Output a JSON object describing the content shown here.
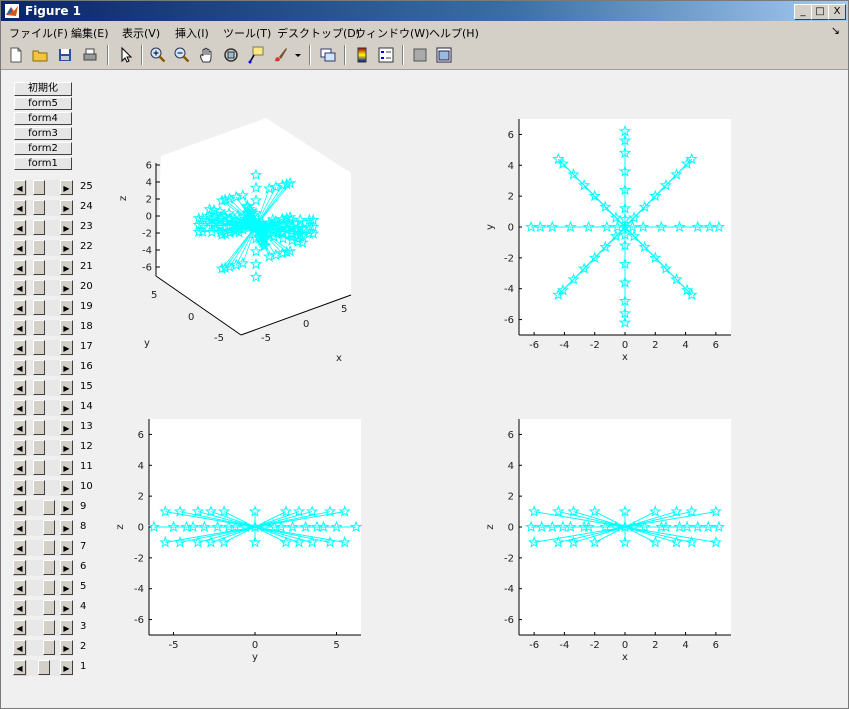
{
  "window": {
    "title": "Figure 1"
  },
  "titlebar_buttons": [
    "_",
    "□",
    "X"
  ],
  "menu": [
    "ファイル(F)",
    "編集(E)",
    "表示(V)",
    "挿入(I)",
    "ツール(T)",
    "デスクトップ(D)",
    "ウィンドウ(W)",
    "ヘルプ(H)"
  ],
  "toolbar_icons": [
    "new-file-icon",
    "open-folder-icon",
    "save-icon",
    "print-icon",
    "pointer-icon",
    "zoom-in-icon",
    "zoom-out-icon",
    "pan-hand-icon",
    "rotate-3d-icon",
    "data-cursor-icon",
    "brush-icon",
    "link-plot-icon",
    "colorbar-icon",
    "legend-icon",
    "hide-plot-tools-icon",
    "show-plot-tools-icon"
  ],
  "buttons": [
    "初期化",
    "form5",
    "form4",
    "form3",
    "form2",
    "form1"
  ],
  "sliders": [
    {
      "label": "25",
      "value": 0.32
    },
    {
      "label": "24",
      "value": 0.32
    },
    {
      "label": "23",
      "value": 0.32
    },
    {
      "label": "22",
      "value": 0.32
    },
    {
      "label": "21",
      "value": 0.32
    },
    {
      "label": "20",
      "value": 0.32
    },
    {
      "label": "19",
      "value": 0.32
    },
    {
      "label": "18",
      "value": 0.32
    },
    {
      "label": "17",
      "value": 0.32
    },
    {
      "label": "16",
      "value": 0.32
    },
    {
      "label": "15",
      "value": 0.32
    },
    {
      "label": "14",
      "value": 0.32
    },
    {
      "label": "13",
      "value": 0.32
    },
    {
      "label": "12",
      "value": 0.32
    },
    {
      "label": "11",
      "value": 0.32
    },
    {
      "label": "10",
      "value": 0.32
    },
    {
      "label": "9",
      "value": 0.78
    },
    {
      "label": "8",
      "value": 0.78
    },
    {
      "label": "7",
      "value": 0.78
    },
    {
      "label": "6",
      "value": 0.78
    },
    {
      "label": "5",
      "value": 0.78
    },
    {
      "label": "4",
      "value": 0.78
    },
    {
      "label": "3",
      "value": 0.78
    },
    {
      "label": "2",
      "value": 0.78
    },
    {
      "label": "1",
      "value": 0.55
    }
  ],
  "colors": {
    "series": "#00ffff",
    "axes_bg": "#ffffff",
    "figure_bg": "#f0f0f0"
  },
  "chart_data": [
    {
      "type": "scatter",
      "subtype": "3d-view",
      "xlabel": "x",
      "ylabel": "y",
      "zlabel": "z",
      "zticks": [
        "6",
        "4",
        "2",
        "0",
        "-2",
        "-4",
        "-6"
      ],
      "xticks": [
        "-5",
        "0",
        "5"
      ],
      "yticks": [
        "5",
        "0",
        "-5"
      ],
      "marker": "pentagram",
      "series": [
        {
          "values": []
        }
      ]
    },
    {
      "type": "line",
      "view": "top",
      "xlabel": "x",
      "ylabel": "y",
      "xlim": [
        -7,
        7
      ],
      "ylim": [
        -7,
        7
      ],
      "xticks": [
        "-6",
        "-4",
        "-2",
        "0",
        "2",
        "4",
        "6"
      ],
      "yticks": [
        "6",
        "4",
        "2",
        "0",
        "-2",
        "-4",
        "-6"
      ],
      "marker": "pentagram",
      "series": [
        {
          "points": [
            [
              0.5,
              0
            ],
            [
              1.2,
              0
            ],
            [
              2.4,
              0
            ],
            [
              3.6,
              0
            ],
            [
              4.8,
              0
            ],
            [
              5.6,
              0
            ],
            [
              6.2,
              0
            ],
            [
              -0.5,
              0
            ],
            [
              -1.2,
              0
            ],
            [
              -2.4,
              0
            ],
            [
              -3.6,
              0
            ],
            [
              -4.8,
              0
            ],
            [
              -5.6,
              0
            ],
            [
              -6.2,
              0
            ],
            [
              0,
              0.5
            ],
            [
              0,
              1.2
            ],
            [
              0,
              2.4
            ],
            [
              0,
              3.6
            ],
            [
              0,
              4.8
            ],
            [
              0,
              5.6
            ],
            [
              0,
              6.2
            ],
            [
              0,
              -0.5
            ],
            [
              0,
              -1.2
            ],
            [
              0,
              -2.4
            ],
            [
              0,
              -3.6
            ],
            [
              0,
              -4.8
            ],
            [
              0,
              -5.6
            ],
            [
              0,
              -6.2
            ],
            [
              0.6,
              0.6
            ],
            [
              1.3,
              1.3
            ],
            [
              2.0,
              2.0
            ],
            [
              2.7,
              2.7
            ],
            [
              3.4,
              3.4
            ],
            [
              4.1,
              4.1
            ],
            [
              4.4,
              4.4
            ],
            [
              -0.6,
              0.6
            ],
            [
              -1.3,
              1.3
            ],
            [
              -2.0,
              2.0
            ],
            [
              -2.7,
              2.7
            ],
            [
              -3.4,
              3.4
            ],
            [
              -4.1,
              4.1
            ],
            [
              -4.4,
              4.4
            ],
            [
              0.6,
              -0.6
            ],
            [
              1.3,
              -1.3
            ],
            [
              2.0,
              -2.0
            ],
            [
              2.7,
              -2.7
            ],
            [
              3.4,
              -3.4
            ],
            [
              4.1,
              -4.1
            ],
            [
              4.4,
              -4.4
            ],
            [
              -0.6,
              -0.6
            ],
            [
              -1.3,
              -1.3
            ],
            [
              -2.0,
              -2.0
            ],
            [
              -2.7,
              -2.7
            ],
            [
              -3.4,
              -3.4
            ],
            [
              -4.1,
              -4.1
            ],
            [
              -4.4,
              -4.4
            ]
          ]
        }
      ]
    },
    {
      "type": "line",
      "view": "side-yz",
      "xlabel": "y",
      "ylabel": "z",
      "xlim": [
        -6.5,
        6.5
      ],
      "ylim": [
        -7,
        7
      ],
      "xticks": [
        "-5",
        "0",
        "5"
      ],
      "yticks": [
        "6",
        "4",
        "2",
        "0",
        "-2",
        "-4",
        "-6"
      ],
      "marker": "pentagram",
      "series": [
        {
          "points": [
            [
              -6.2,
              0
            ],
            [
              -5.5,
              1
            ],
            [
              -5.5,
              -1
            ],
            [
              -5.0,
              0
            ],
            [
              -4.6,
              1
            ],
            [
              -4.6,
              -1
            ],
            [
              -4.2,
              0
            ],
            [
              -3.8,
              0
            ],
            [
              -3.5,
              1
            ],
            [
              -3.5,
              -1
            ],
            [
              -3.1,
              0
            ],
            [
              -2.7,
              1
            ],
            [
              -2.7,
              -1
            ],
            [
              -2.3,
              0
            ],
            [
              -1.9,
              1
            ],
            [
              -1.9,
              -1
            ],
            [
              -1.6,
              0
            ],
            [
              -1.2,
              0
            ],
            [
              -0.6,
              0
            ],
            [
              0,
              0
            ],
            [
              0,
              1
            ],
            [
              0,
              -1
            ],
            [
              0.6,
              0
            ],
            [
              1.2,
              0
            ],
            [
              1.6,
              0
            ],
            [
              1.9,
              1
            ],
            [
              1.9,
              -1
            ],
            [
              2.3,
              0
            ],
            [
              2.7,
              1
            ],
            [
              2.7,
              -1
            ],
            [
              3.1,
              0
            ],
            [
              3.5,
              1
            ],
            [
              3.5,
              -1
            ],
            [
              3.8,
              0
            ],
            [
              4.2,
              0
            ],
            [
              4.6,
              1
            ],
            [
              4.6,
              -1
            ],
            [
              5.0,
              0
            ],
            [
              5.5,
              1
            ],
            [
              5.5,
              -1
            ],
            [
              6.2,
              0
            ]
          ]
        }
      ]
    },
    {
      "type": "line",
      "view": "side-xz",
      "xlabel": "x",
      "ylabel": "z",
      "xlim": [
        -7,
        7
      ],
      "ylim": [
        -7,
        7
      ],
      "xticks": [
        "-6",
        "-4",
        "-2",
        "0",
        "2",
        "4",
        "6"
      ],
      "yticks": [
        "6",
        "4",
        "2",
        "0",
        "-2",
        "-4",
        "-6"
      ],
      "marker": "pentagram",
      "series": [
        {
          "points": [
            [
              -6.2,
              0
            ],
            [
              -6.0,
              1
            ],
            [
              -6.0,
              -1
            ],
            [
              -5.5,
              0
            ],
            [
              -4.8,
              0
            ],
            [
              -4.4,
              1
            ],
            [
              -4.4,
              -1
            ],
            [
              -4.1,
              0
            ],
            [
              -3.6,
              0
            ],
            [
              -3.4,
              1
            ],
            [
              -3.4,
              -1
            ],
            [
              -2.7,
              0
            ],
            [
              -2.4,
              0
            ],
            [
              -2.0,
              1
            ],
            [
              -2.0,
              -1
            ],
            [
              -1.3,
              0
            ],
            [
              -0.6,
              0
            ],
            [
              0,
              0
            ],
            [
              0,
              1
            ],
            [
              0,
              -1
            ],
            [
              0.6,
              0
            ],
            [
              1.3,
              0
            ],
            [
              2.0,
              1
            ],
            [
              2.0,
              -1
            ],
            [
              2.4,
              0
            ],
            [
              2.7,
              0
            ],
            [
              3.4,
              1
            ],
            [
              3.4,
              -1
            ],
            [
              3.6,
              0
            ],
            [
              4.1,
              0
            ],
            [
              4.4,
              1
            ],
            [
              4.4,
              -1
            ],
            [
              4.8,
              0
            ],
            [
              5.5,
              0
            ],
            [
              6.0,
              1
            ],
            [
              6.0,
              -1
            ],
            [
              6.2,
              0
            ]
          ]
        }
      ]
    }
  ]
}
